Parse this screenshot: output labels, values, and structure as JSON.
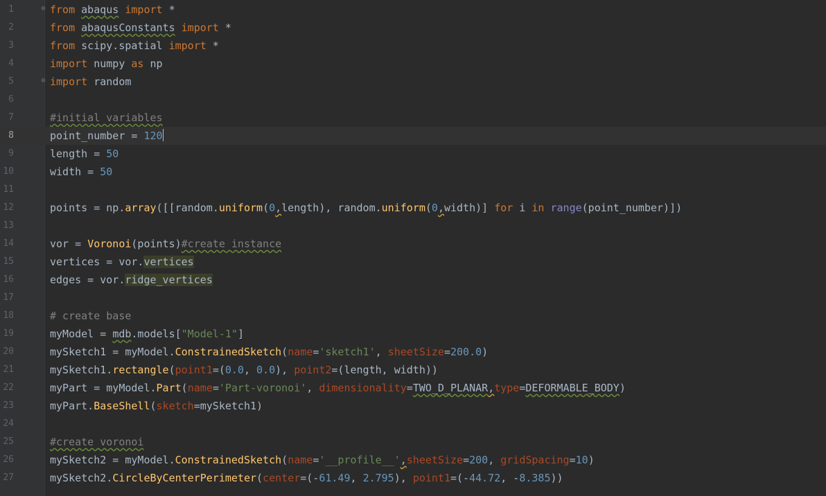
{
  "editor": {
    "colors": {
      "background": "#2b2b2b",
      "gutter": "#313335",
      "keyword": "#cc7832",
      "number": "#6897bb",
      "function": "#ffc66d",
      "string": "#6a8759",
      "comment": "#808080",
      "parameter": "#aa4926",
      "default_text": "#a9b7c6"
    },
    "current_line": 8,
    "lines": [
      {
        "n": "1",
        "tokens": [
          [
            "kw",
            "from"
          ],
          [
            "t",
            " "
          ],
          [
            "typo",
            "abaqus"
          ],
          [
            "t",
            " "
          ],
          [
            "kw",
            "import"
          ],
          [
            "t",
            " *"
          ]
        ]
      },
      {
        "n": "2",
        "tokens": [
          [
            "kw",
            "from"
          ],
          [
            "t",
            " "
          ],
          [
            "typo",
            "abaqusConstants"
          ],
          [
            "t",
            " "
          ],
          [
            "kw",
            "import"
          ],
          [
            "t",
            " *"
          ]
        ]
      },
      {
        "n": "3",
        "tokens": [
          [
            "kw",
            "from"
          ],
          [
            "t",
            " scipy.spatial "
          ],
          [
            "kw",
            "import"
          ],
          [
            "t",
            " *"
          ]
        ]
      },
      {
        "n": "4",
        "tokens": [
          [
            "kw",
            "import"
          ],
          [
            "t",
            " numpy "
          ],
          [
            "kw",
            "as"
          ],
          [
            "t",
            " np"
          ]
        ]
      },
      {
        "n": "5",
        "tokens": [
          [
            "kw",
            "import"
          ],
          [
            "t",
            " random"
          ]
        ]
      },
      {
        "n": "6",
        "tokens": []
      },
      {
        "n": "7",
        "tokens": [
          [
            "cm-typo",
            "#initial variables"
          ]
        ]
      },
      {
        "n": "8",
        "tokens": [
          [
            "t",
            "point_number = "
          ],
          [
            "num",
            "120"
          ],
          [
            "caret",
            ""
          ]
        ]
      },
      {
        "n": "9",
        "tokens": [
          [
            "t",
            "length = "
          ],
          [
            "num",
            "50"
          ]
        ]
      },
      {
        "n": "10",
        "tokens": [
          [
            "t",
            "width = "
          ],
          [
            "num",
            "50"
          ]
        ]
      },
      {
        "n": "11",
        "tokens": []
      },
      {
        "n": "12",
        "tokens": [
          [
            "t",
            "points = np."
          ],
          [
            "fn",
            "array"
          ],
          [
            "t",
            "([[random."
          ],
          [
            "fn",
            "uniform"
          ],
          [
            "t",
            "("
          ],
          [
            "num",
            "0"
          ],
          [
            "warn",
            ","
          ],
          [
            "t",
            "length), random."
          ],
          [
            "fn",
            "uniform"
          ],
          [
            "t",
            "("
          ],
          [
            "num",
            "0"
          ],
          [
            "warn",
            ","
          ],
          [
            "t",
            "width)] "
          ],
          [
            "kw",
            "for"
          ],
          [
            "t",
            " i "
          ],
          [
            "kw",
            "in"
          ],
          [
            "t",
            " "
          ],
          [
            "builtin",
            "range"
          ],
          [
            "t",
            "(point_number)])"
          ]
        ]
      },
      {
        "n": "13",
        "tokens": []
      },
      {
        "n": "14",
        "tokens": [
          [
            "t",
            "vor = "
          ],
          [
            "fn",
            "Voronoi"
          ],
          [
            "t",
            "(points)"
          ],
          [
            "cm-typo",
            "#create instance"
          ]
        ]
      },
      {
        "n": "15",
        "tokens": [
          [
            "t",
            "vertices = vor."
          ],
          [
            "hl",
            "vertices"
          ]
        ]
      },
      {
        "n": "16",
        "tokens": [
          [
            "t",
            "edges = vor."
          ],
          [
            "hl",
            "ridge_vertices"
          ]
        ]
      },
      {
        "n": "17",
        "tokens": []
      },
      {
        "n": "18",
        "tokens": [
          [
            "cm",
            "# create base"
          ]
        ]
      },
      {
        "n": "19",
        "tokens": [
          [
            "t",
            "myModel = "
          ],
          [
            "typo",
            "mdb"
          ],
          [
            "t",
            ".models["
          ],
          [
            "str",
            "\"Model-1\""
          ],
          [
            "t",
            "]"
          ]
        ]
      },
      {
        "n": "20",
        "tokens": [
          [
            "t",
            "mySketch1 = myModel."
          ],
          [
            "fn",
            "ConstrainedSketch"
          ],
          [
            "t",
            "("
          ],
          [
            "param",
            "name"
          ],
          [
            "t",
            "="
          ],
          [
            "str",
            "'sketch1'"
          ],
          [
            "t",
            ", "
          ],
          [
            "param",
            "sheetSize"
          ],
          [
            "t",
            "="
          ],
          [
            "num",
            "200.0"
          ],
          [
            "t",
            ")"
          ]
        ]
      },
      {
        "n": "21",
        "tokens": [
          [
            "t",
            "mySketch1."
          ],
          [
            "fn",
            "rectangle"
          ],
          [
            "t",
            "("
          ],
          [
            "param",
            "point1"
          ],
          [
            "t",
            "=("
          ],
          [
            "num",
            "0.0"
          ],
          [
            "t",
            ", "
          ],
          [
            "num",
            "0.0"
          ],
          [
            "t",
            "), "
          ],
          [
            "param",
            "point2"
          ],
          [
            "t",
            "=(length, width))"
          ]
        ]
      },
      {
        "n": "22",
        "tokens": [
          [
            "t",
            "myPart = myModel."
          ],
          [
            "fn",
            "Part"
          ],
          [
            "t",
            "("
          ],
          [
            "param",
            "name"
          ],
          [
            "t",
            "="
          ],
          [
            "str",
            "'Part-voronoi'"
          ],
          [
            "t",
            ", "
          ],
          [
            "param",
            "dimensionality"
          ],
          [
            "t",
            "="
          ],
          [
            "typo",
            "TWO_D_PLANAR"
          ],
          [
            "warn",
            ","
          ],
          [
            "param",
            "type"
          ],
          [
            "t",
            "="
          ],
          [
            "typo",
            "DEFORMABLE_BODY"
          ],
          [
            "t",
            ")"
          ]
        ]
      },
      {
        "n": "23",
        "tokens": [
          [
            "t",
            "myPart."
          ],
          [
            "fn",
            "BaseShell"
          ],
          [
            "t",
            "("
          ],
          [
            "param",
            "sketch"
          ],
          [
            "t",
            "=mySketch1)"
          ]
        ]
      },
      {
        "n": "24",
        "tokens": []
      },
      {
        "n": "25",
        "tokens": [
          [
            "cm-typo",
            "#create voronoi"
          ]
        ]
      },
      {
        "n": "26",
        "tokens": [
          [
            "t",
            "mySketch2 = myModel."
          ],
          [
            "fn",
            "ConstrainedSketch"
          ],
          [
            "t",
            "("
          ],
          [
            "param",
            "name"
          ],
          [
            "t",
            "="
          ],
          [
            "str",
            "'__profile__'"
          ],
          [
            "warn",
            ","
          ],
          [
            "param",
            "sheetSize"
          ],
          [
            "t",
            "="
          ],
          [
            "num",
            "200"
          ],
          [
            "t",
            ", "
          ],
          [
            "param",
            "gridSpacing"
          ],
          [
            "t",
            "="
          ],
          [
            "num",
            "10"
          ],
          [
            "t",
            ")"
          ]
        ]
      },
      {
        "n": "27",
        "tokens": [
          [
            "t",
            "mySketch2."
          ],
          [
            "fn",
            "CircleByCenterPerimeter"
          ],
          [
            "t",
            "("
          ],
          [
            "param",
            "center"
          ],
          [
            "t",
            "=(-"
          ],
          [
            "num",
            "61.49"
          ],
          [
            "t",
            ", "
          ],
          [
            "num",
            "2.795"
          ],
          [
            "t",
            "), "
          ],
          [
            "param",
            "point1"
          ],
          [
            "t",
            "=(-"
          ],
          [
            "num",
            "44.72"
          ],
          [
            "t",
            ", -"
          ],
          [
            "num",
            "8.385"
          ],
          [
            "t",
            "))"
          ]
        ]
      }
    ],
    "fold_markers": {
      "1": "⊖",
      "5": "⊖"
    }
  }
}
